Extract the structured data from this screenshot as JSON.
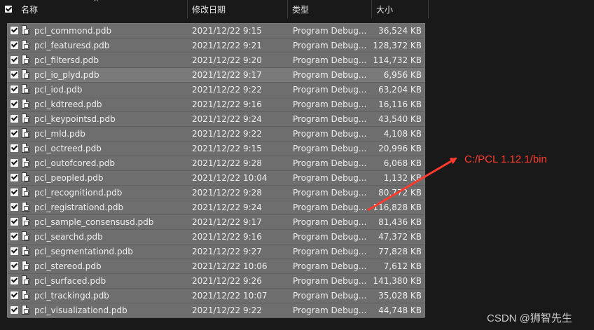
{
  "header": {
    "name_label": "名称",
    "date_label": "修改日期",
    "type_label": "类型",
    "size_label": "大小",
    "sort_indicator": "^"
  },
  "files": [
    {
      "name": "pcl_commond.pdb",
      "date": "2021/12/22 9:15",
      "type": "Program Debug...",
      "size": "36,524 KB"
    },
    {
      "name": "pcl_featuresd.pdb",
      "date": "2021/12/22 9:21",
      "type": "Program Debug...",
      "size": "128,372 KB"
    },
    {
      "name": "pcl_filtersd.pdb",
      "date": "2021/12/22 9:20",
      "type": "Program Debug...",
      "size": "114,732 KB"
    },
    {
      "name": "pcl_io_plyd.pdb",
      "date": "2021/12/22 9:17",
      "type": "Program Debug...",
      "size": "6,956 KB"
    },
    {
      "name": "pcl_iod.pdb",
      "date": "2021/12/22 9:22",
      "type": "Program Debug...",
      "size": "63,204 KB"
    },
    {
      "name": "pcl_kdtreed.pdb",
      "date": "2021/12/22 9:16",
      "type": "Program Debug...",
      "size": "16,116 KB"
    },
    {
      "name": "pcl_keypointsd.pdb",
      "date": "2021/12/22 9:24",
      "type": "Program Debug...",
      "size": "43,540 KB"
    },
    {
      "name": "pcl_mld.pdb",
      "date": "2021/12/22 9:22",
      "type": "Program Debug...",
      "size": "4,108 KB"
    },
    {
      "name": "pcl_octreed.pdb",
      "date": "2021/12/22 9:15",
      "type": "Program Debug...",
      "size": "20,996 KB"
    },
    {
      "name": "pcl_outofcored.pdb",
      "date": "2021/12/22 9:28",
      "type": "Program Debug...",
      "size": "6,068 KB"
    },
    {
      "name": "pcl_peopled.pdb",
      "date": "2021/12/22 10:04",
      "type": "Program Debug...",
      "size": "1,132 KB"
    },
    {
      "name": "pcl_recognitiond.pdb",
      "date": "2021/12/22 9:28",
      "type": "Program Debug...",
      "size": "80,772 KB"
    },
    {
      "name": "pcl_registrationd.pdb",
      "date": "2021/12/22 9:24",
      "type": "Program Debug...",
      "size": "116,828 KB"
    },
    {
      "name": "pcl_sample_consensusd.pdb",
      "date": "2021/12/22 9:17",
      "type": "Program Debug...",
      "size": "81,436 KB"
    },
    {
      "name": "pcl_searchd.pdb",
      "date": "2021/12/22 9:16",
      "type": "Program Debug...",
      "size": "47,372 KB"
    },
    {
      "name": "pcl_segmentationd.pdb",
      "date": "2021/12/22 9:27",
      "type": "Program Debug...",
      "size": "77,828 KB"
    },
    {
      "name": "pcl_stereod.pdb",
      "date": "2021/12/22 10:06",
      "type": "Program Debug...",
      "size": "7,612 KB"
    },
    {
      "name": "pcl_surfaced.pdb",
      "date": "2021/12/22 9:26",
      "type": "Program Debug...",
      "size": "141,380 KB"
    },
    {
      "name": "pcl_trackingd.pdb",
      "date": "2021/12/22 10:07",
      "type": "Program Debug...",
      "size": "35,028 KB"
    },
    {
      "name": "pcl_visualizationd.pdb",
      "date": "2021/12/22 9:22",
      "type": "Program Debug...",
      "size": "44,748 KB"
    }
  ],
  "annotation": {
    "text": "C:/PCL 1.12.1/bin",
    "color": "#ff3b30"
  },
  "watermark": "CSDN @狮智先生"
}
